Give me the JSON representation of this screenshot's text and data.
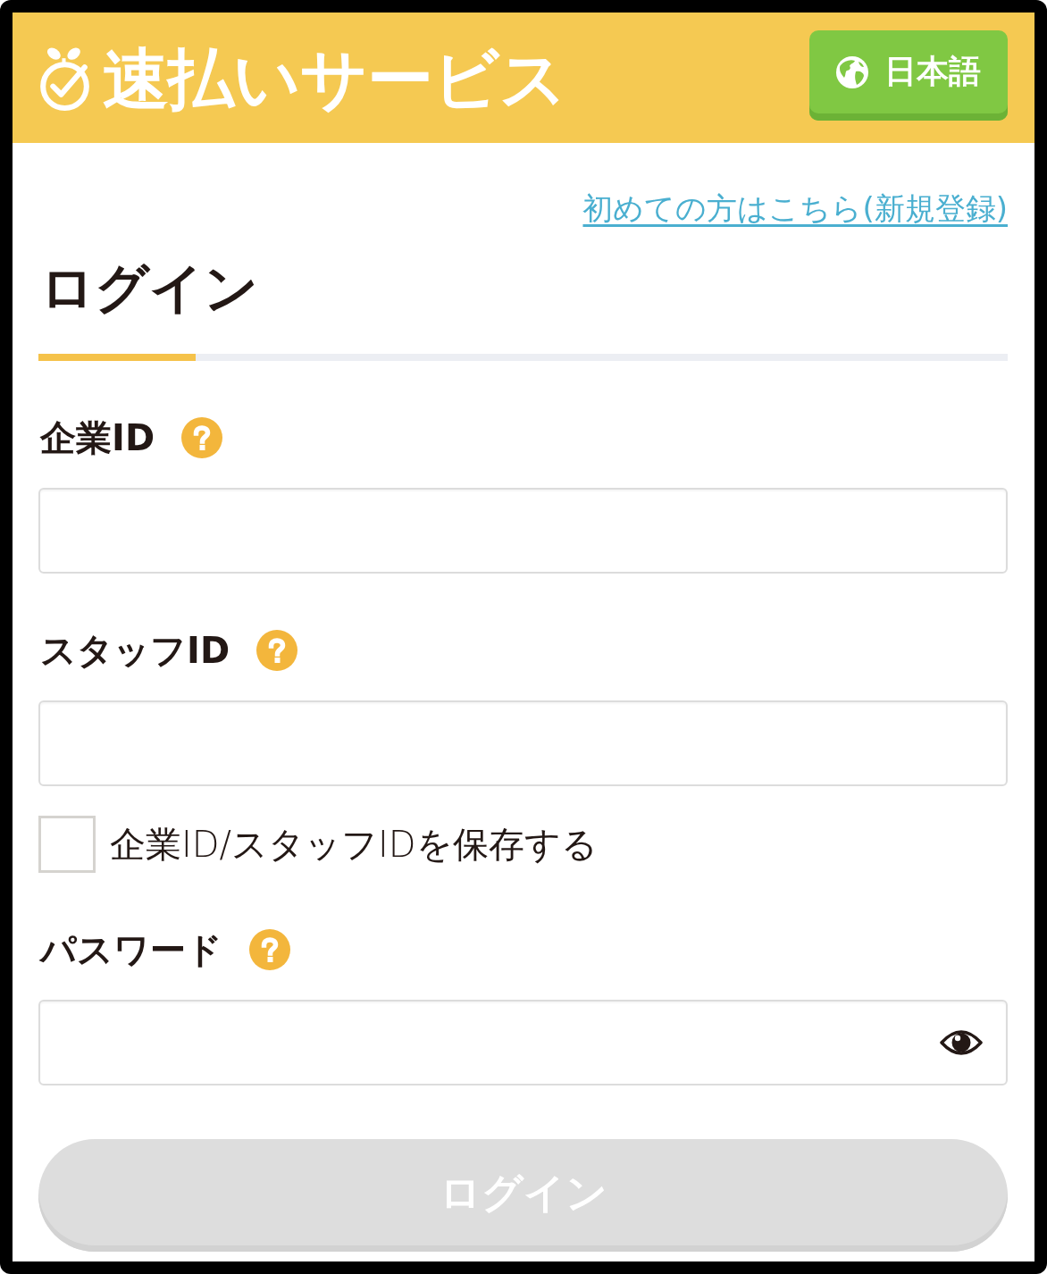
{
  "header": {
    "title": "速払いサービス",
    "language_button": "日本語"
  },
  "register_link": "初めての方はこちら(新規登録)",
  "heading": "ログイン",
  "form": [
    {
      "kind": "text",
      "label": "企業ID"
    },
    {
      "kind": "text",
      "label": "スタッフID"
    },
    {
      "kind": "checkbox",
      "label": "企業ID/スタッフIDを保存する",
      "checked": false
    },
    {
      "kind": "password",
      "label": "パスワード"
    }
  ],
  "login_button": {
    "label": "ログイン",
    "disabled": true
  }
}
